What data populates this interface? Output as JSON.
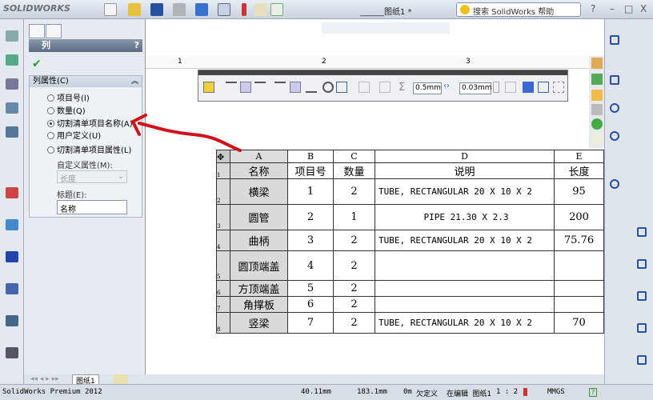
{
  "app": {
    "logo": "SOLIDWORKS",
    "doc_title": "______图纸1 *",
    "search_placeholder": "搜索 SolidWorks 帮助",
    "help": "?",
    "minimize": "–",
    "maximize": "□",
    "close": "X"
  },
  "panel": {
    "title": "列",
    "help": "?",
    "ok": "✔",
    "group_title": "列属性(C)",
    "options": [
      {
        "label": "项目号(I)",
        "selected": false
      },
      {
        "label": "数量(Q)",
        "selected": false
      },
      {
        "label": "切割清单项目名称(A)",
        "selected": true
      },
      {
        "label": "用户定义(U)",
        "selected": false
      },
      {
        "label": "切割清单项目属性(L)",
        "selected": false
      }
    ],
    "custom_prop_label": "自定义属性(M):",
    "custom_prop_value": "长度",
    "title_label": "标题(E):",
    "title_value": "名称"
  },
  "ruler": [
    "1",
    "2",
    "3"
  ],
  "format_toolbar": {
    "line_width": "0.5mm",
    "text_margin": "0.03mm",
    "sum": "Σ"
  },
  "table": {
    "columns": [
      "A",
      "B",
      "C",
      "D",
      "E"
    ],
    "rows": [
      {
        "num": "1",
        "cells": [
          "名称",
          "项目号",
          "数量",
          "说明",
          "长度"
        ]
      },
      {
        "num": "2",
        "cells": [
          "横梁",
          "1",
          "2",
          "TUBE, RECTANGULAR 20 X 10 X 2",
          "95"
        ]
      },
      {
        "num": "3",
        "cells": [
          "圆管",
          "2",
          "1",
          "PIPE 21.30 X 2.3",
          "200"
        ]
      },
      {
        "num": "4",
        "cells": [
          "曲柄",
          "3",
          "2",
          "TUBE, RECTANGULAR 20 X 10 X 2",
          "75.76"
        ]
      },
      {
        "num": "5",
        "cells": [
          "圆顶端盖",
          "4",
          "2",
          "",
          ""
        ]
      },
      {
        "num": "6",
        "cells": [
          "方顶端盖",
          "5",
          "2",
          "",
          ""
        ]
      },
      {
        "num": "7",
        "cells": [
          "角撑板",
          "6",
          "2",
          "",
          ""
        ]
      },
      {
        "num": "8",
        "cells": [
          "竖梁",
          "7",
          "2",
          "TUBE, RECTANGULAR 20 X 10 X 2",
          "70"
        ]
      }
    ]
  },
  "sheet_tab": "图纸1",
  "status": {
    "product": "SolidWorks Premium 2012",
    "x": "40.11mm",
    "y": "183.1mm",
    "z": "0m",
    "state": "欠定义",
    "mode": "在编辑 图纸1",
    "scale": "1 : 2",
    "units": "MMGS"
  },
  "colors": {
    "annotation_arrow": "#d0101a",
    "panel_header": "#5d6c83"
  }
}
